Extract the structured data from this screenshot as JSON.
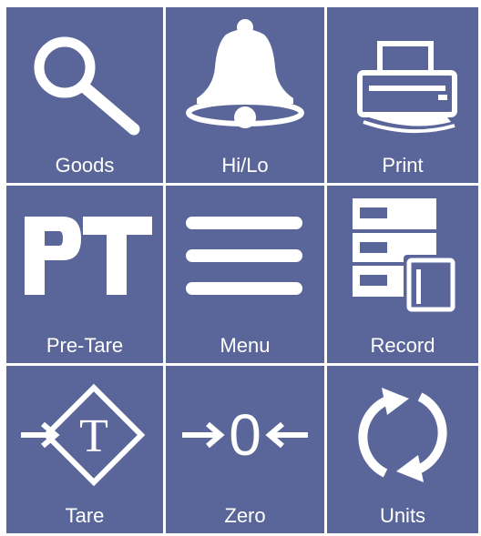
{
  "tiles": [
    {
      "label": "Goods",
      "icon": "search-icon"
    },
    {
      "label": "Hi/Lo",
      "icon": "bell-icon"
    },
    {
      "label": "Print",
      "icon": "printer-icon"
    },
    {
      "label": "Pre-Tare",
      "icon": "pt-icon",
      "icon_text": "PT"
    },
    {
      "label": "Menu",
      "icon": "menu-icon"
    },
    {
      "label": "Record",
      "icon": "record-icon"
    },
    {
      "label": "Tare",
      "icon": "tare-icon",
      "icon_text": "T"
    },
    {
      "label": "Zero",
      "icon": "zero-icon",
      "icon_text": "0"
    },
    {
      "label": "Units",
      "icon": "units-cycle-icon"
    }
  ],
  "colors": {
    "tile_bg": "#5a6699",
    "icon": "#ffffff",
    "text": "#ffffff"
  }
}
